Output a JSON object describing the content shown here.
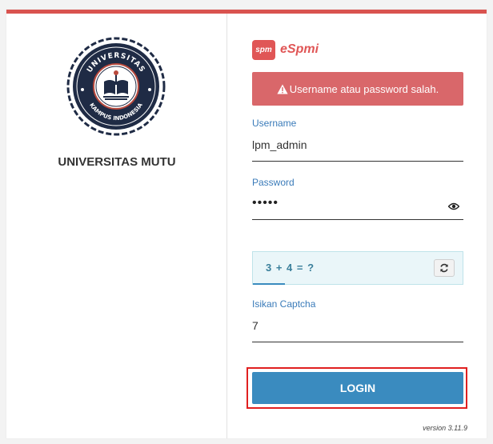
{
  "university": {
    "name": "UNIVERSITAS MUTU",
    "seal_text_top": "UNIVERSITAS",
    "seal_text_bottom": "KAMPUS INDONESIA"
  },
  "brand": {
    "badge": "spm",
    "name": "eSpmi"
  },
  "alert": {
    "message": "Username atau password salah."
  },
  "form": {
    "username_label": "Username",
    "username_value": "lpm_admin",
    "password_label": "Password",
    "password_value": "•••••",
    "captcha_question": "3 + 4 = ?",
    "captcha_label": "Isikan Captcha",
    "captcha_value": "7",
    "login_label": "LOGIN"
  },
  "footer": {
    "version": "version 3.11.9"
  },
  "colors": {
    "accent_red": "#d9534f",
    "primary_blue": "#3a8bbf",
    "label_blue": "#3a7bb9",
    "seal_navy": "#1f2b45"
  }
}
